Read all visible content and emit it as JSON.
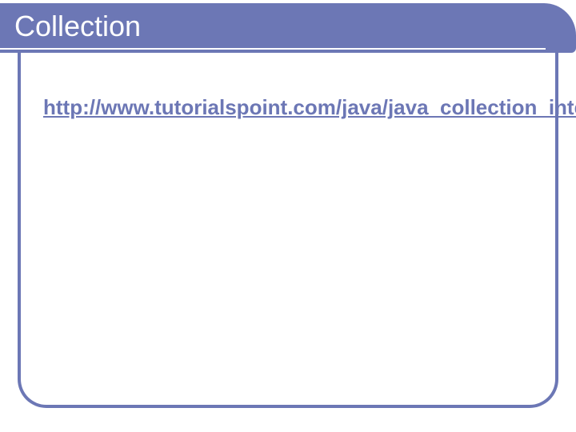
{
  "slide": {
    "title": "Collection",
    "link_text": "http://www.tutorialspoint.com/java/java_collection_interface.htm",
    "link_href": "http://www.tutorialspoint.com/java/java_collection_interface.htm"
  },
  "colors": {
    "accent": "#6c77b5"
  }
}
